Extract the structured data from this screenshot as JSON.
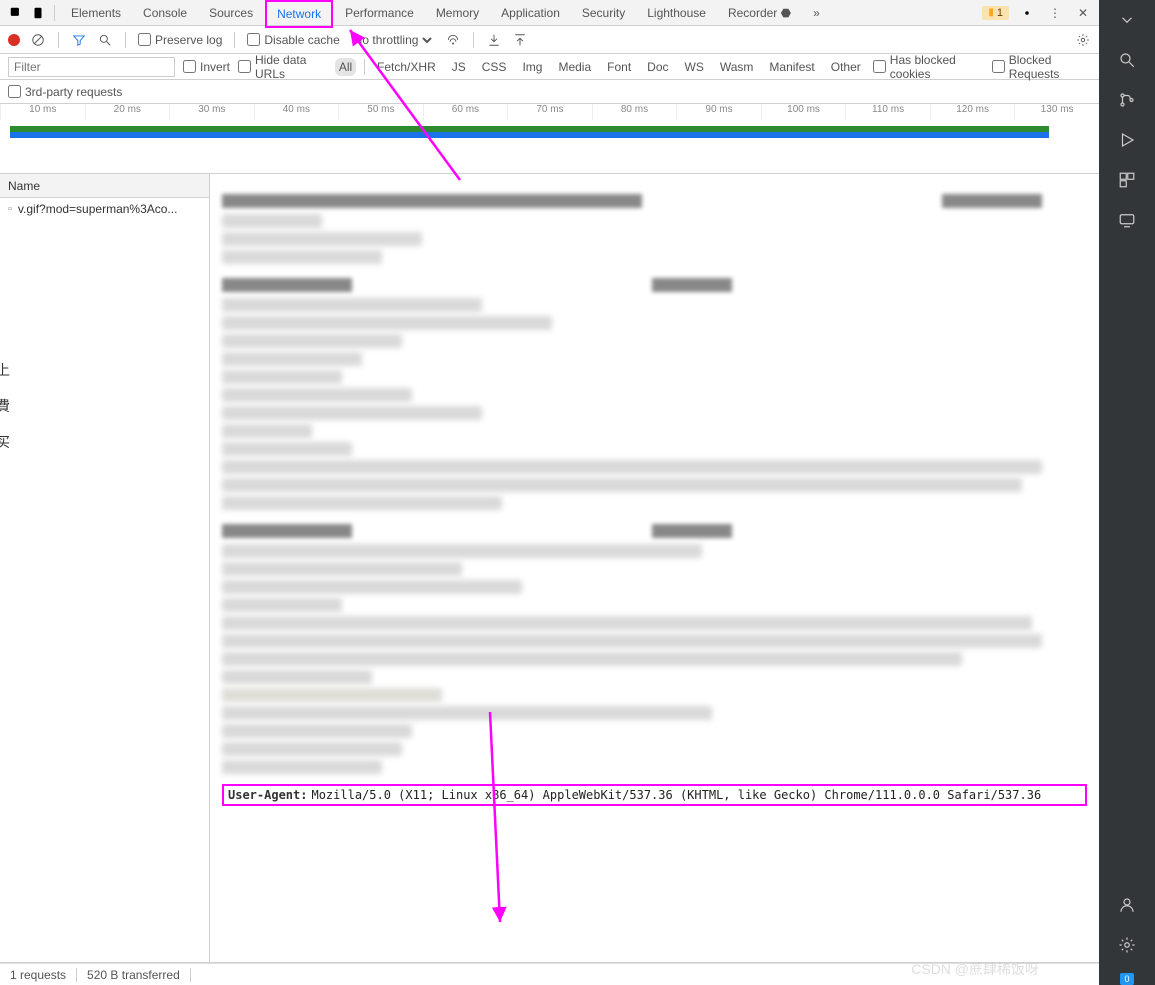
{
  "tabs": [
    "Elements",
    "Console",
    "Sources",
    "Network",
    "Performance",
    "Memory",
    "Application",
    "Security",
    "Lighthouse",
    "Recorder"
  ],
  "activeTab": "Network",
  "warnCount": "1",
  "toolbar": {
    "preserve_log": "Preserve log",
    "disable_cache": "Disable cache",
    "throttling": "No throttling"
  },
  "filter": {
    "placeholder": "Filter",
    "invert": "Invert",
    "hide_data_urls": "Hide data URLs",
    "types": [
      "All",
      "Fetch/XHR",
      "JS",
      "CSS",
      "Img",
      "Media",
      "Font",
      "Doc",
      "WS",
      "Wasm",
      "Manifest",
      "Other"
    ],
    "blocked_cookies": "Has blocked cookies",
    "blocked_requests": "Blocked Requests",
    "third_party": "3rd-party requests"
  },
  "timeline": {
    "ticks": [
      "10 ms",
      "20 ms",
      "30 ms",
      "40 ms",
      "50 ms",
      "60 ms",
      "70 ms",
      "80 ms",
      "90 ms",
      "100 ms",
      "110 ms",
      "120 ms",
      "130 ms"
    ]
  },
  "name_header": "Name",
  "requests": [
    {
      "name": "v.gif?mod=superman%3Aco..."
    }
  ],
  "ua": {
    "key": "User-Agent:",
    "value": "Mozilla/5.0 (X11; Linux x86_64) AppleWebKit/537.36 (KHTML, like Gecko) Chrome/111.0.0.0 Safari/537.36"
  },
  "status": {
    "requests": "1 requests",
    "transferred": "520 B transferred"
  },
  "watermark": "CSDN @蔗肆稀饭呀",
  "rightBadge": "0"
}
